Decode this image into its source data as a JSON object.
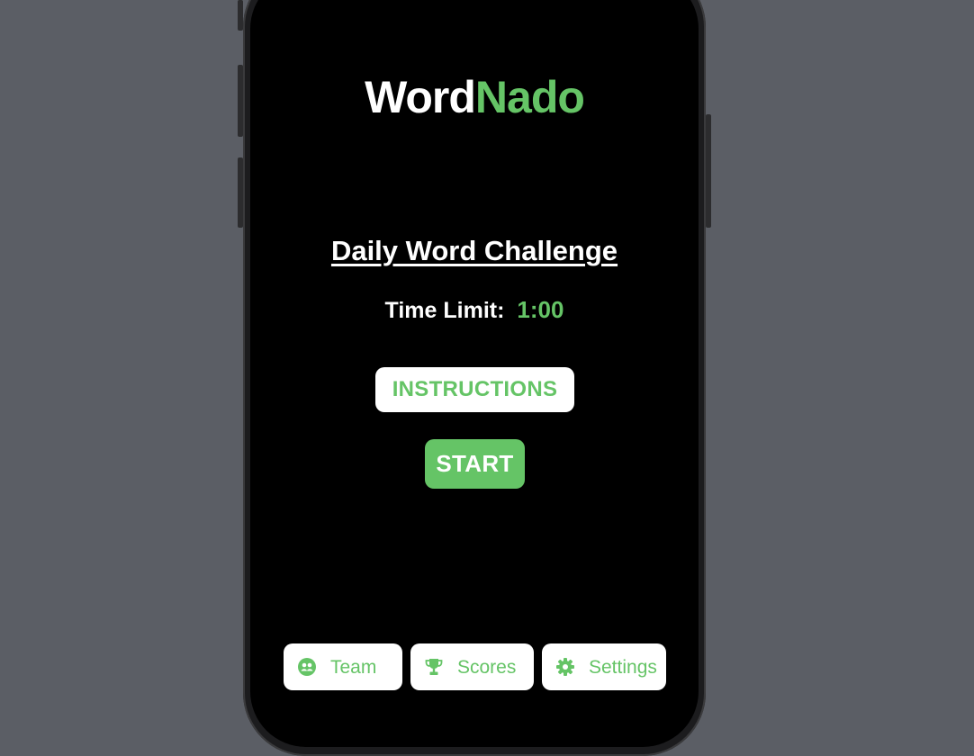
{
  "app": {
    "title_part_1": "Word",
    "title_part_2": "Nado"
  },
  "challenge": {
    "heading": "Daily Word Challenge",
    "time_label": "Time Limit:",
    "time_value": "1:00"
  },
  "actions": {
    "instructions_label": "INSTRUCTIONS",
    "start_label": "START"
  },
  "nav": {
    "items": [
      {
        "label": "Team",
        "icon": "team-icon"
      },
      {
        "label": "Scores",
        "icon": "trophy-icon"
      },
      {
        "label": "Settings",
        "icon": "gear-icon"
      }
    ]
  },
  "colors": {
    "accent": "#65c466",
    "background": "#000000",
    "surface": "#ffffff",
    "desktop": "#5b5e65"
  }
}
